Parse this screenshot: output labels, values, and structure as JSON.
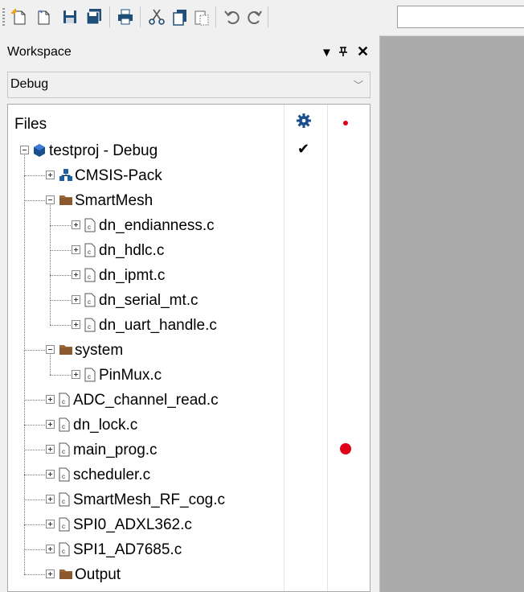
{
  "toolbar": {
    "buttons": [
      {
        "name": "new-file-button",
        "icon": "new-file-icon"
      },
      {
        "name": "new-doc-button",
        "icon": "new-doc-icon"
      },
      {
        "name": "save-button",
        "icon": "save-icon"
      },
      {
        "name": "save-all-button",
        "icon": "save-all-icon"
      },
      {
        "name": "print-button",
        "icon": "printer-icon"
      },
      {
        "name": "cut-button",
        "icon": "scissors-icon"
      },
      {
        "name": "copy-button",
        "icon": "copy-icon"
      },
      {
        "name": "paste-button",
        "icon": "paste-icon"
      },
      {
        "name": "undo-button",
        "icon": "undo-icon"
      },
      {
        "name": "redo-button",
        "icon": "redo-icon"
      }
    ],
    "combo_value": ""
  },
  "workspace": {
    "title": "Workspace",
    "menu_icon": "dropdown-triangle-icon",
    "pin_icon": "pin-icon",
    "close_icon": "close-icon",
    "config_value": "Debug"
  },
  "tree": {
    "header": "Files",
    "rows": [
      {
        "label": "testproj - Debug",
        "type": "project",
        "expander": "minus",
        "checked": true,
        "breakpoint": false
      },
      {
        "label": "CMSIS-Pack",
        "type": "pack",
        "expander": "plus",
        "breakpoint": false
      },
      {
        "label": "SmartMesh",
        "type": "folder",
        "expander": "minus",
        "breakpoint": false
      },
      {
        "label": "dn_endianness.c",
        "type": "cfile",
        "expander": "plus",
        "breakpoint": false
      },
      {
        "label": "dn_hdlc.c",
        "type": "cfile",
        "expander": "plus",
        "breakpoint": false
      },
      {
        "label": "dn_ipmt.c",
        "type": "cfile",
        "expander": "plus",
        "breakpoint": false
      },
      {
        "label": "dn_serial_mt.c",
        "type": "cfile",
        "expander": "plus",
        "breakpoint": false
      },
      {
        "label": "dn_uart_handle.c",
        "type": "cfile",
        "expander": "plus",
        "breakpoint": false
      },
      {
        "label": "system",
        "type": "folder",
        "expander": "minus",
        "breakpoint": false
      },
      {
        "label": "PinMux.c",
        "type": "cfile",
        "expander": "plus",
        "breakpoint": false
      },
      {
        "label": "ADC_channel_read.c",
        "type": "cfile",
        "expander": "plus",
        "breakpoint": false
      },
      {
        "label": "dn_lock.c",
        "type": "cfile",
        "expander": "plus",
        "breakpoint": false
      },
      {
        "label": "main_prog.c",
        "type": "cfile",
        "expander": "plus",
        "breakpoint": true
      },
      {
        "label": "scheduler.c",
        "type": "cfile",
        "expander": "plus",
        "breakpoint": false
      },
      {
        "label": "SmartMesh_RF_cog.c",
        "type": "cfile",
        "expander": "plus",
        "breakpoint": false
      },
      {
        "label": "SPI0_ADXL362.c",
        "type": "cfile",
        "expander": "plus",
        "breakpoint": false
      },
      {
        "label": "SPI1_AD7685.c",
        "type": "cfile",
        "expander": "plus",
        "breakpoint": false
      },
      {
        "label": "Output",
        "type": "folder",
        "expander": "plus",
        "breakpoint": false
      }
    ]
  },
  "colors": {
    "folder": "#9b6a3c",
    "project": "#1a4e8c",
    "pack": "#1f5fa0",
    "breakpoint": "#e0001a"
  }
}
